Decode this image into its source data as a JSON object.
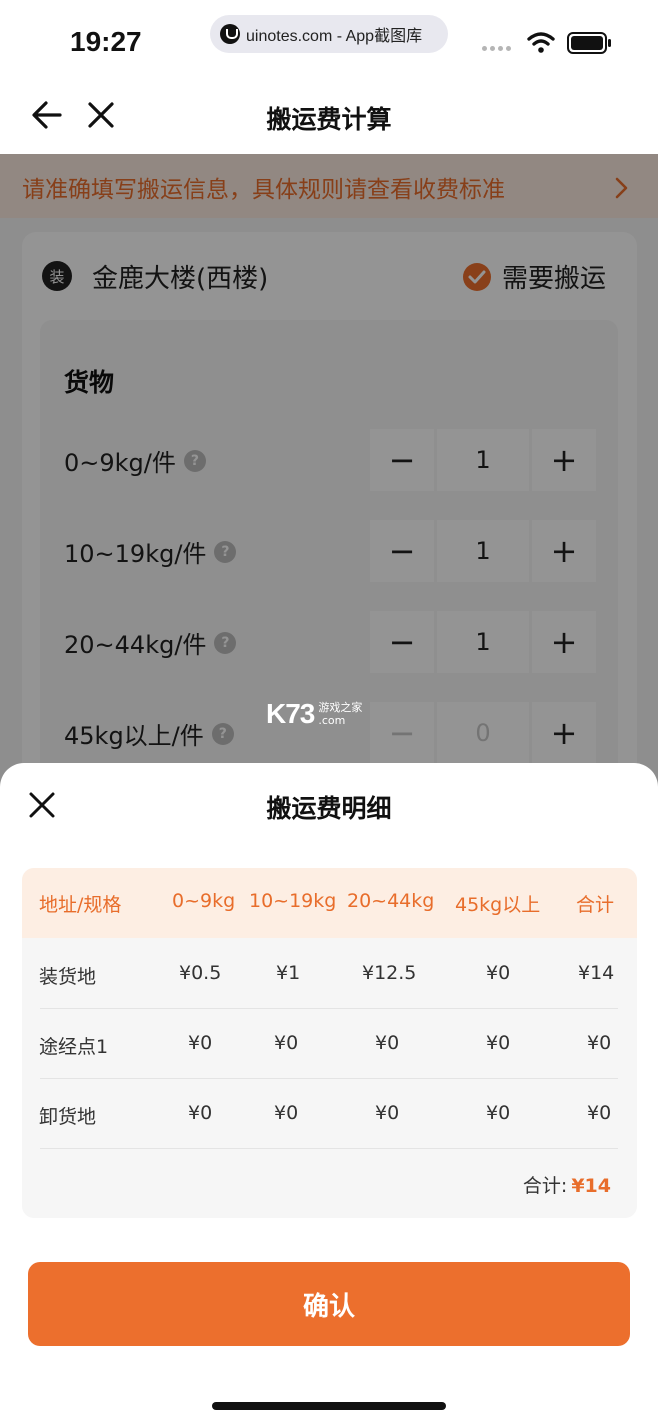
{
  "status_bar": {
    "time": "19:27",
    "url": "uinotes.com - App截图库"
  },
  "nav": {
    "title": "搬运费计算"
  },
  "notice": {
    "text": "请准确填写搬运信息，具体规则请查看收费标准"
  },
  "card": {
    "badge": "装",
    "address": "金鹿大楼(西楼)",
    "need_move_label": "需要搬运",
    "goods_title": "货物",
    "rows": [
      {
        "label": "0~9kg/件",
        "value": "1"
      },
      {
        "label": "10~19kg/件",
        "value": "1"
      },
      {
        "label": "20~44kg/件",
        "value": "1"
      },
      {
        "label": "45kg以上/件",
        "value": "0"
      }
    ],
    "help_glyph": "?",
    "minus_glyph": "−",
    "plus_glyph": "+"
  },
  "watermark": {
    "logo": "K73",
    "line1": "游戏之家",
    "line2": ".com"
  },
  "sheet": {
    "title": "搬运费明细",
    "headers": [
      "地址/规格",
      "0~9kg",
      "10~19kg",
      "20~44kg",
      "45kg以上",
      "合计"
    ],
    "rows": [
      [
        "装货地",
        "¥0.5",
        "¥1",
        "¥12.5",
        "¥0",
        "¥14"
      ],
      [
        "途经点1",
        "¥0",
        "¥0",
        "¥0",
        "¥0",
        "¥0"
      ],
      [
        "卸货地",
        "¥0",
        "¥0",
        "¥0",
        "¥0",
        "¥0"
      ]
    ],
    "total_label": "合计:",
    "total_value": "¥14",
    "confirm_label": "确认"
  },
  "colors": {
    "accent": "#ec6f2d",
    "header_bg": "#fdeee3"
  }
}
